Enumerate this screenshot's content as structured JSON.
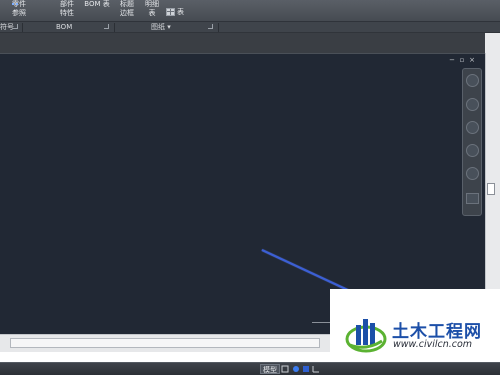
{
  "ribbon": {
    "buttons": [
      {
        "line1": "零件",
        "line2": "参照",
        "icon": "part-reference-icon"
      },
      {
        "line1": "部件",
        "line2": "特性",
        "icon": "component-properties-icon"
      },
      {
        "line1": "BOM 表",
        "line2": "",
        "icon": "bom-table-icon"
      },
      {
        "line1": "标题",
        "line2": "边框",
        "icon": "title-border-icon"
      },
      {
        "line1": "明细",
        "line2": "表",
        "icon": "detail-table-icon"
      },
      {
        "line1": "表",
        "line2": "",
        "icon": "table-icon"
      }
    ],
    "panels": [
      {
        "label": "符号",
        "partial": true
      },
      {
        "label": "BOM"
      },
      {
        "label": "图纸 ▾"
      }
    ]
  },
  "window_controls": {
    "restore": "▫",
    "close": "×",
    "minimize": "−"
  },
  "navigation_bar": {
    "tools": [
      "steering-wheel-icon",
      "pan-icon",
      "orbit-icon",
      "zoom-extents-icon",
      "zoom-icon",
      "showmotion-icon"
    ]
  },
  "status": {
    "model_label": "模型"
  },
  "watermark": {
    "title": "土木工程网",
    "url": "www.civilcn.com"
  },
  "colors": {
    "canvas": "#212834",
    "line": "#3b5fd6",
    "logo_blue": "#1c4fa8",
    "logo_green": "#5bb232"
  }
}
